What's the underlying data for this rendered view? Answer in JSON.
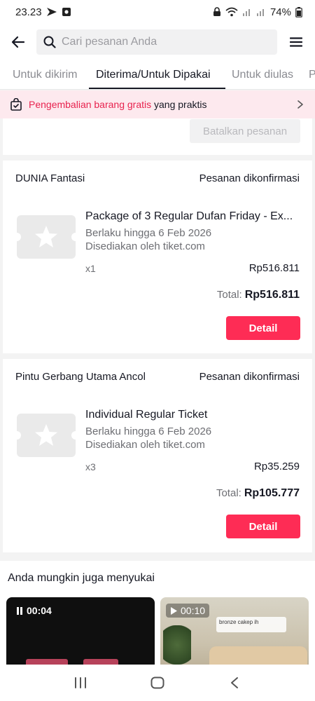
{
  "status_bar": {
    "time": "23.23",
    "battery": "74%"
  },
  "search": {
    "placeholder": "Cari pesanan Anda"
  },
  "tabs": [
    {
      "label": "Untuk dikirim",
      "active": false
    },
    {
      "label": "Diterima/Untuk Dipakai",
      "active": true
    },
    {
      "label": "Untuk diulas",
      "active": false
    },
    {
      "label": "P",
      "active": false
    }
  ],
  "banner": {
    "highlight": "Pengembalian barang gratis",
    "rest": "yang praktis"
  },
  "top_card": {
    "button_label": "Batalkan pesanan"
  },
  "orders": [
    {
      "store": "DUNIA Fantasi",
      "status": "Pesanan dikonfirmasi",
      "product": "Package of 3 Regular Dufan Friday - Ex...",
      "valid_until": "Berlaku hingga 6 Feb 2026",
      "provider": "Disediakan oleh tiket.com",
      "quantity": "x1",
      "price": "Rp516.811",
      "total_label": "Total:",
      "total": "Rp516.811",
      "button_label": "Detail"
    },
    {
      "store": "Pintu Gerbang Utama Ancol",
      "status": "Pesanan dikonfirmasi",
      "product": "Individual Regular Ticket",
      "valid_until": "Berlaku hingga 6 Feb 2026",
      "provider": "Disediakan oleh tiket.com",
      "quantity": "x3",
      "price": "Rp35.259",
      "total_label": "Total:",
      "total": "Rp105.777",
      "button_label": "Detail"
    }
  ],
  "recommendations": {
    "title": "Anda mungkin juga menyukai",
    "videos": [
      {
        "duration": "00:04",
        "state_icon": "pause-icon"
      },
      {
        "duration": "00:10",
        "state_icon": "play-icon",
        "caption": "bronze cakep ih"
      }
    ]
  },
  "colors": {
    "accent": "#fe2c55",
    "banner_bg": "#fde9ee",
    "banner_highlight": "#e8234f"
  }
}
